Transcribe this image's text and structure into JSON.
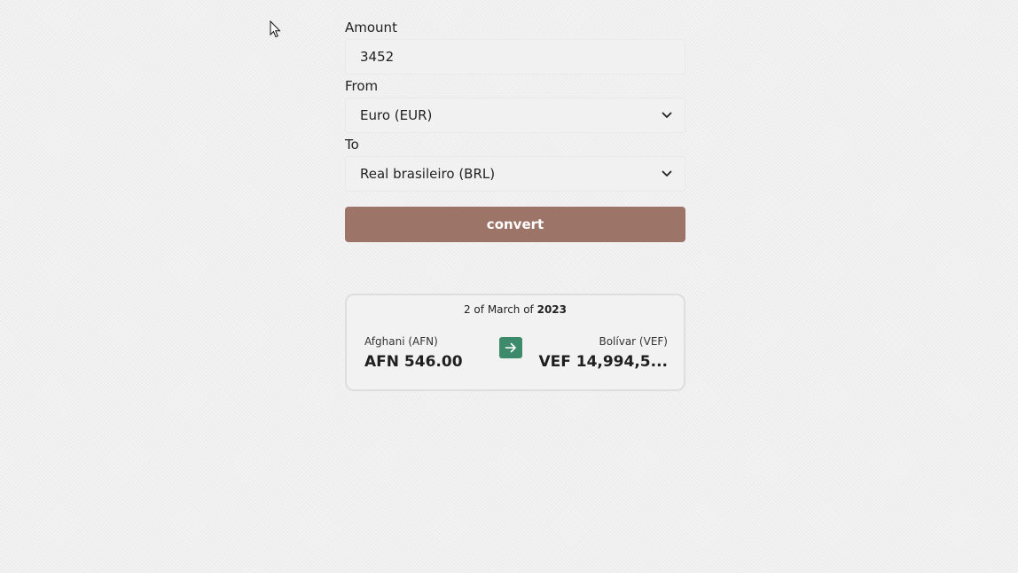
{
  "form": {
    "amount_label": "Amount",
    "amount_value": "3452",
    "from_label": "From",
    "from_value": "Euro (EUR)",
    "to_label": "To",
    "to_value": "Real brasileiro (BRL)",
    "convert_label": "convert"
  },
  "result": {
    "date_prefix": "2 of March of",
    "date_year": "2023",
    "from_currency": "Afghani (AFN)",
    "from_amount": "AFN 546.00",
    "to_currency": "Bolívar (VEF)",
    "to_amount": "VEF 14,994,5..."
  },
  "colors": {
    "convert_button": "#9d7468",
    "swap_arrow": "#3d8a6c"
  },
  "icons": {
    "cursor": "mouse-pointer-icon",
    "dropdown": "chevron-down-icon",
    "arrow": "arrow-right-icon"
  }
}
